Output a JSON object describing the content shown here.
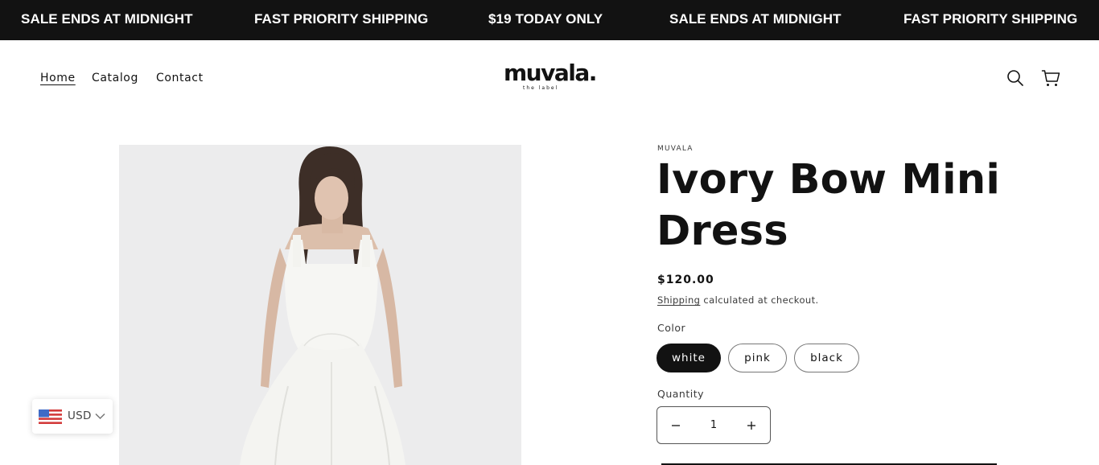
{
  "announcement": {
    "items": [
      "SALE ENDS AT MIDNIGHT",
      "FAST PRIORITY SHIPPING",
      "$19 TODAY ONLY",
      "SALE ENDS AT MIDNIGHT",
      "FAST PRIORITY SHIPPING"
    ]
  },
  "header": {
    "nav": [
      {
        "label": "Home",
        "active": true
      },
      {
        "label": "Catalog",
        "active": false
      },
      {
        "label": "Contact",
        "active": false
      }
    ],
    "logo": {
      "wordmark": "muvala.",
      "sub": "the label"
    },
    "icons": [
      "search-icon",
      "cart-icon"
    ]
  },
  "product": {
    "vendor": "MUVALA",
    "title": "Ivory Bow Mini Dress",
    "price": "$120.00",
    "shipping_link": "Shipping",
    "shipping_text": " calculated at checkout.",
    "color_label": "Color",
    "colors": [
      {
        "label": "white",
        "selected": true
      },
      {
        "label": "pink",
        "selected": false
      },
      {
        "label": "black",
        "selected": false
      }
    ],
    "quantity_label": "Quantity",
    "quantity": "1"
  },
  "currency": {
    "code": "USD",
    "icon": "us-flag-icon"
  },
  "colors": {
    "bar": "#121212",
    "text": "#121212",
    "media_bg": "#ececed"
  }
}
